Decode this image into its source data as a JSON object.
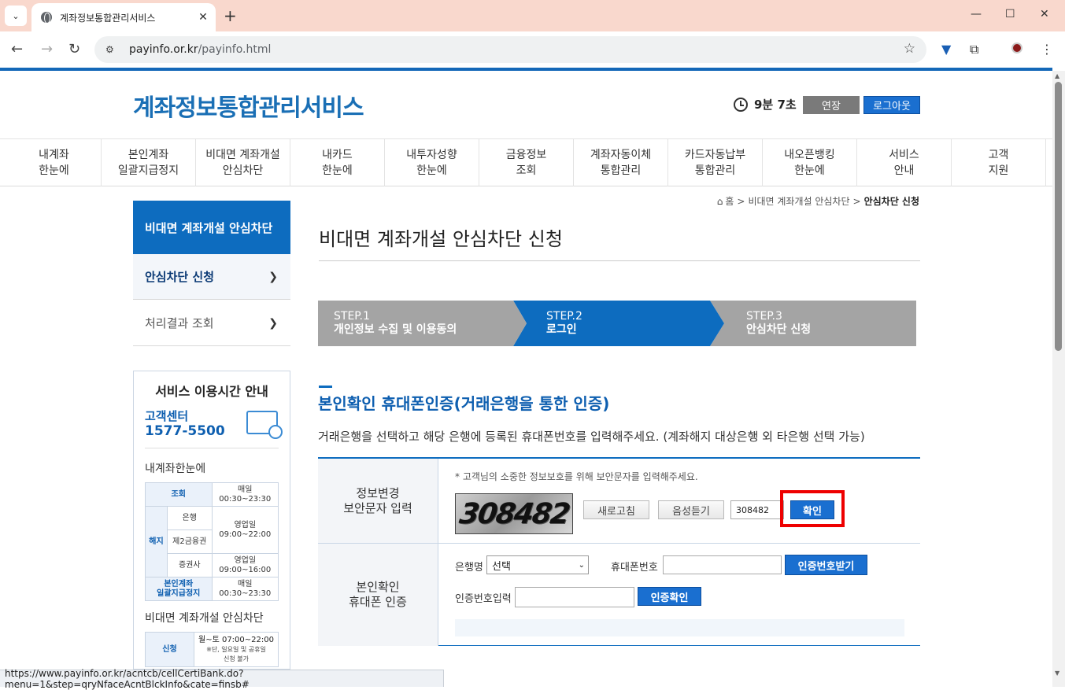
{
  "browser": {
    "tab_title": "계좌정보통합관리서비스",
    "url_domain": "payinfo.or.kr",
    "url_path": "/payinfo.html",
    "status_url": "https://www.payinfo.or.kr/acntcb/cellCertiBank.do?menu=1&step=qryNfaceAcntBlckInfo&cate=finsb#"
  },
  "header": {
    "logo": "계좌정보통합관리서비스",
    "timer": "9분 7초",
    "extend_label": "연장",
    "logout_label": "로그아웃"
  },
  "gnb": [
    "내계좌\n한눈에",
    "본인계좌\n일괄지급정지",
    "비대면 계좌개설\n안심차단",
    "내카드\n한눈에",
    "내투자성향\n한눈에",
    "금융정보\n조회",
    "계좌자동이체\n통합관리",
    "카드자동납부\n통합관리",
    "내오픈뱅킹\n한눈에",
    "서비스\n안내",
    "고객\n지원"
  ],
  "breadcrumb": {
    "home": "홈",
    "level1": "비대면 계좌개설 안심차단",
    "current": "안심차단 신청"
  },
  "lnb": {
    "title": "비대면 계좌개설 안심차단",
    "items": [
      {
        "label": "안심차단 신청"
      },
      {
        "label": "처리결과 조회"
      }
    ]
  },
  "service_hours": {
    "title": "서비스 이용시간 안내",
    "center_label": "고객센터",
    "phone": "1577-5500",
    "section1": "내계좌한눈에",
    "rows": {
      "inquiry": "조회",
      "inquiry_time": "매일\n00:30~23:30",
      "cancel": "해지",
      "bank": "은행",
      "bank_time": "영업일\n09:00~22:00",
      "fin2": "제2금융권",
      "securities": "증권사",
      "securities_time": "영업일\n09:00~16:00",
      "suspend": "본인계좌\n일괄지급정지",
      "suspend_time": "매일\n00:30~23:30"
    },
    "section2": "비대면 계좌개설 안심차단",
    "apply": "신청",
    "apply_time": "월~토 07:00~22:00",
    "apply_note": "※단, 일요일 및 공휴일\n신청 불가"
  },
  "main": {
    "page_title": "비대면 계좌개설 안심차단 신청",
    "steps": [
      {
        "num": "STEP.1",
        "name": "개인정보 수집 및 이용동의"
      },
      {
        "num": "STEP.2",
        "name": "로그인"
      },
      {
        "num": "STEP.3",
        "name": "안심차단 신청"
      }
    ],
    "section_title": "본인확인 휴대폰인증(거래은행을 통한 인증)",
    "section_desc": "거래은행을 선택하고 해당 은행에 등록된 휴대폰번호를 입력해주세요. (계좌해지 대상은행 외 타은행 선택 가능)"
  },
  "form": {
    "row1_label": "정보변경\n보안문자 입력",
    "captcha_note": "* 고객님의 소중한 정보보호를 위해 보안문자를 입력해주세요.",
    "captcha_text": "308482",
    "refresh_label": "새로고침",
    "audio_label": "음성듣기",
    "captcha_value": "308482",
    "confirm_label": "확인",
    "row2_label": "본인확인\n휴대폰 인증",
    "bank_label": "은행명",
    "bank_selected": "선택",
    "phone_label": "휴대폰번호",
    "request_code_label": "인증번호받기",
    "code_label": "인증번호입력",
    "verify_label": "인증확인"
  }
}
